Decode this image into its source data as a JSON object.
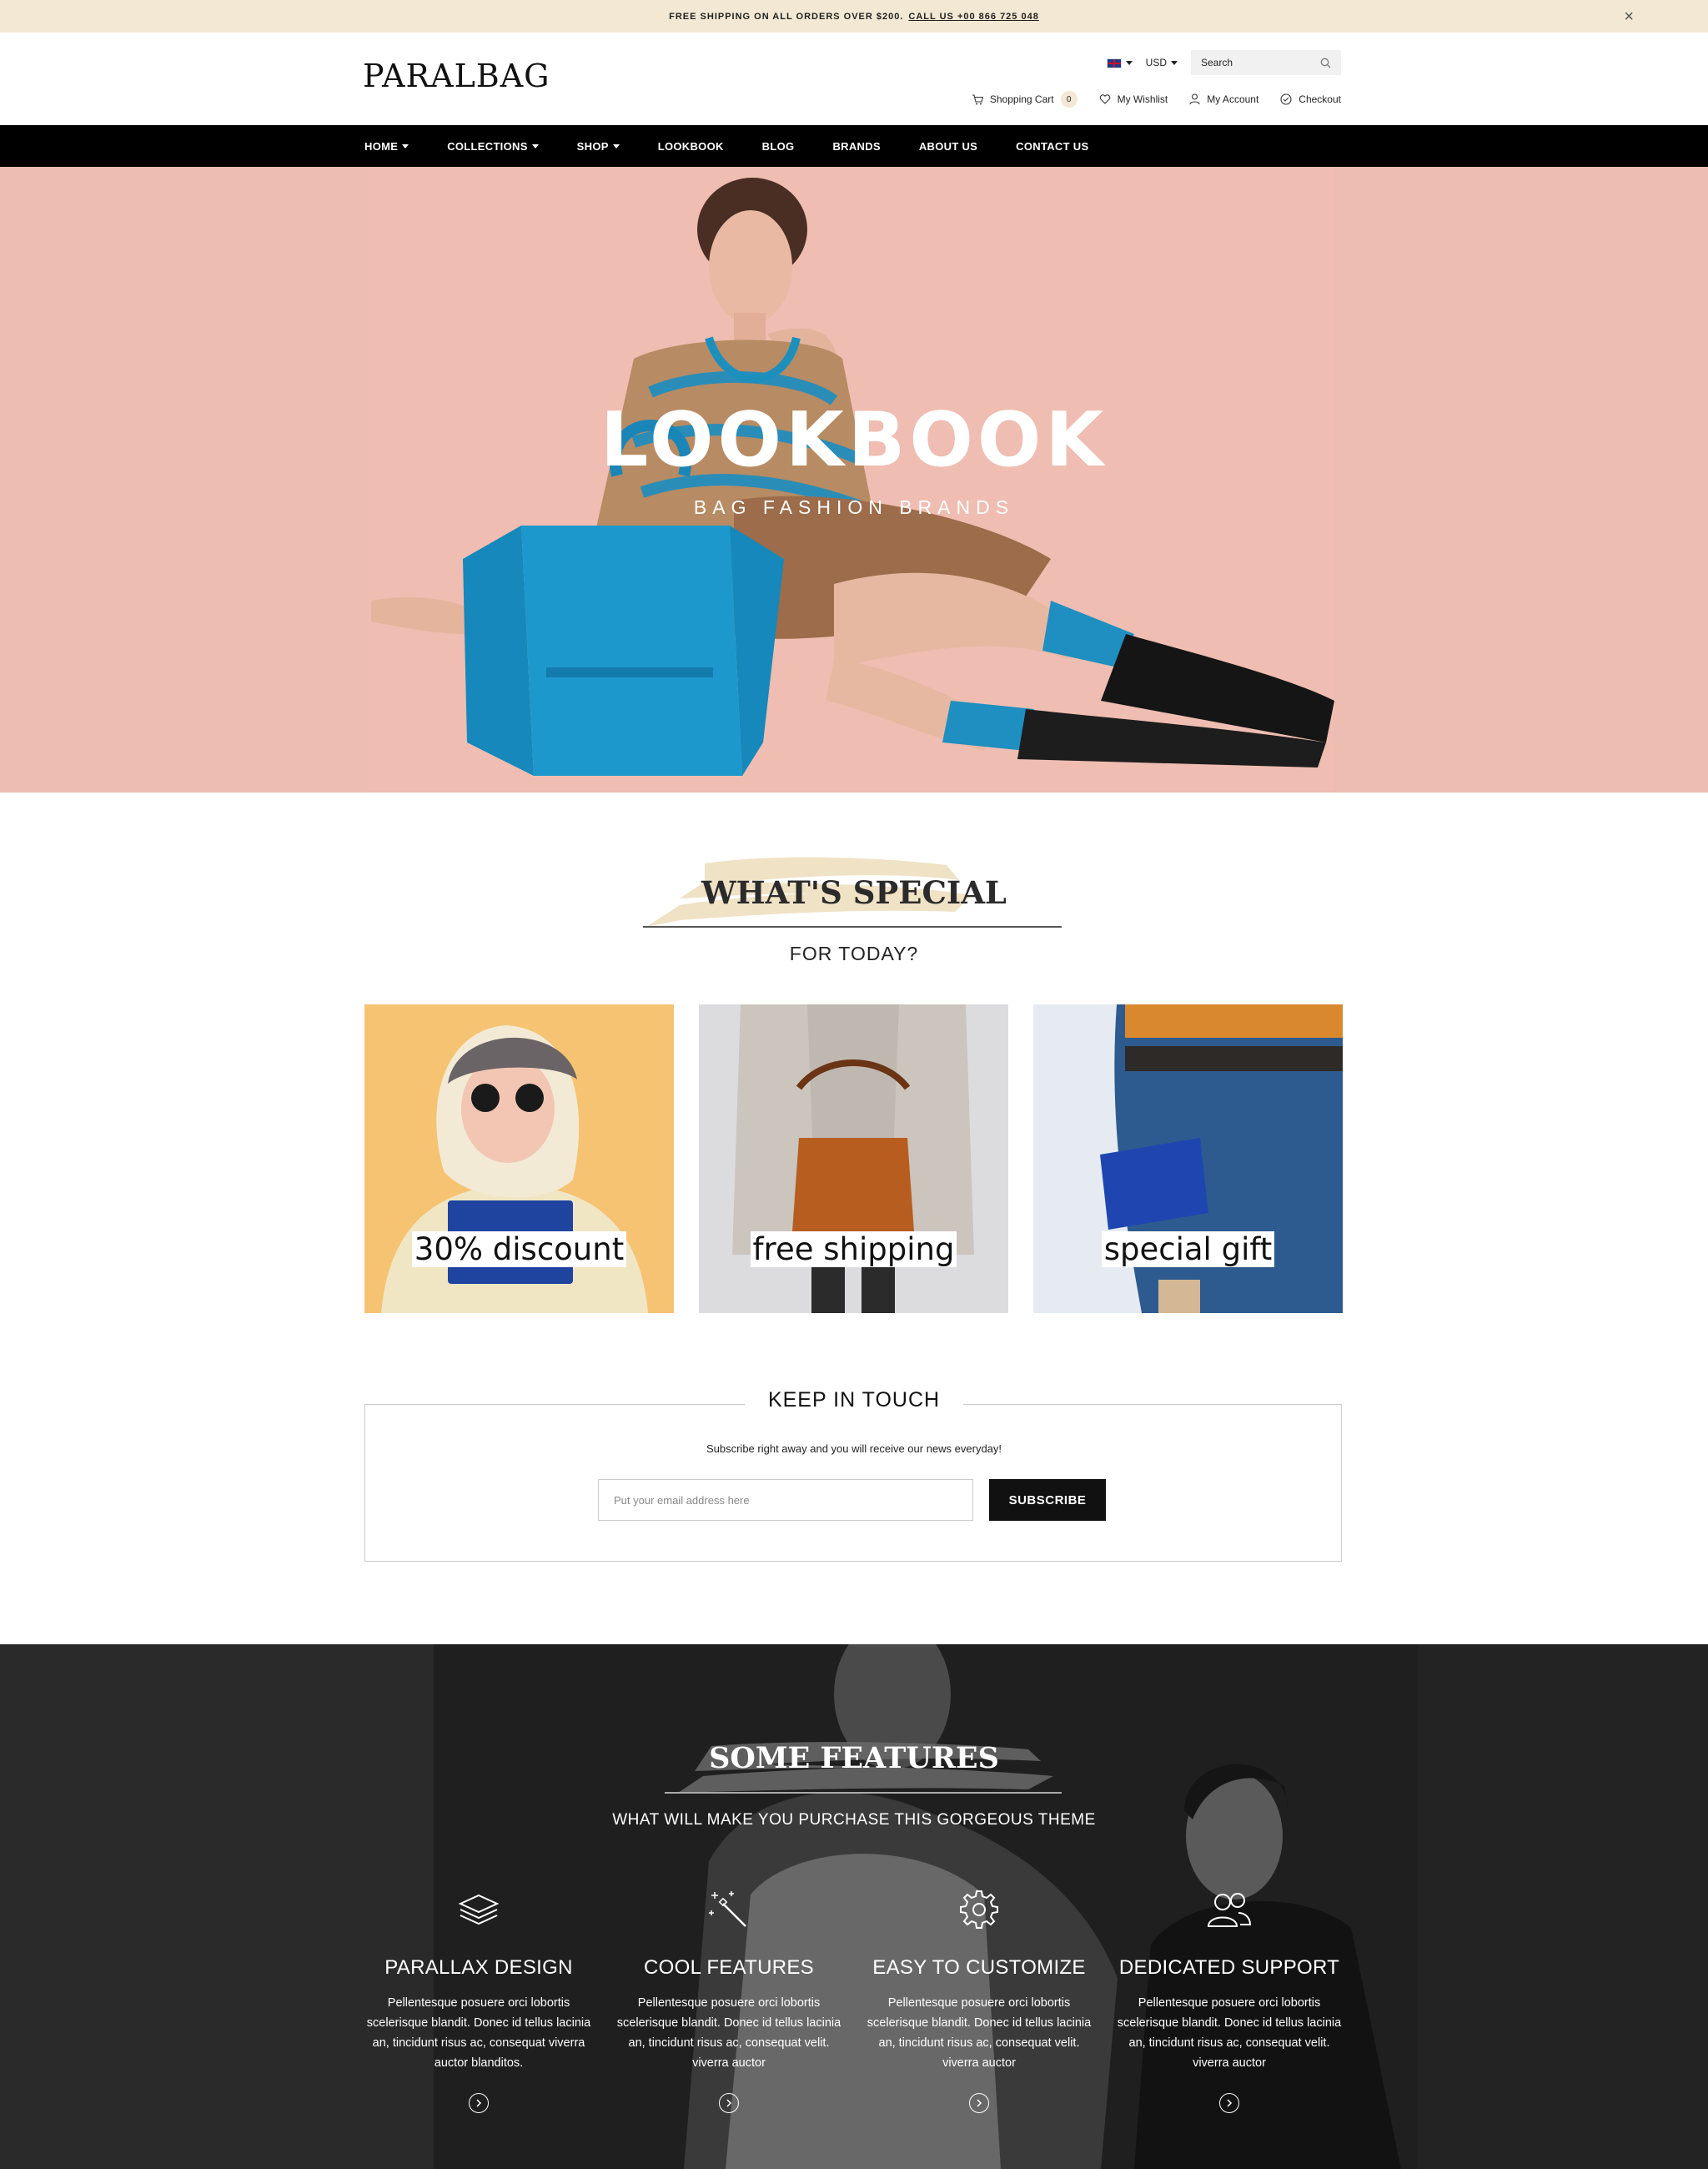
{
  "announcement": {
    "text": "FREE SHIPPING ON ALL ORDERS OVER $200.",
    "phone": "CALL US +00 866 725 048",
    "close": "×"
  },
  "header": {
    "logo": "PARALBAG",
    "currency": "USD",
    "search_label": "Search",
    "links": {
      "cart": "Shopping Cart",
      "cart_count": "0",
      "wishlist": "My Wishlist",
      "account": "My Account",
      "checkout": "Checkout"
    }
  },
  "nav": {
    "items": [
      {
        "label": "HOME"
      },
      {
        "label": "COLLECTIONS"
      },
      {
        "label": "SHOP"
      },
      {
        "label": "LOOKBOOK"
      },
      {
        "label": "BLOG"
      },
      {
        "label": "BRANDS"
      },
      {
        "label": "ABOUT US"
      },
      {
        "label": "CONTACT US"
      }
    ]
  },
  "hero": {
    "title": "LOOKBOOK",
    "subtitle": "BAG FASHION BRANDS",
    "bg_color": "#eebdb2"
  },
  "special": {
    "title": "WHAT'S SPECIAL",
    "subtitle": "FOR TODAY?",
    "cards": [
      {
        "label": "30% discount",
        "bg": "#f5c372"
      },
      {
        "label": "free shipping",
        "bg": "#dcdcdf"
      },
      {
        "label": "special gift",
        "bg": "#e6ebf2"
      }
    ]
  },
  "newsletter": {
    "title": "KEEP IN TOUCH",
    "text": "Subscribe right away and you will receive our news everyday!",
    "placeholder": "Put your email address here",
    "button": "SUBSCRIBE"
  },
  "features": {
    "title": "SOME FEATURES",
    "subtitle": "WHAT WILL MAKE YOU PURCHASE THIS GORGEOUS THEME",
    "items": [
      {
        "icon": "layers-icon",
        "title": "PARALLAX DESIGN",
        "text": "Pellentesque posuere orci lobortis scelerisque blandit. Donec id tellus lacinia an, tincidunt risus ac, consequat viverra auctor blanditos."
      },
      {
        "icon": "magic-wand-icon",
        "title": "COOL FEATURES",
        "text": "Pellentesque posuere orci lobortis scelerisque blandit. Donec id tellus lacinia an, tincidunt risus ac, consequat velit. viverra auctor"
      },
      {
        "icon": "gear-icon",
        "title": "EASY TO CUSTOMIZE",
        "text": "Pellentesque posuere orci lobortis scelerisque blandit. Donec id tellus lacinia an, tincidunt risus ac, consequat velit. viverra auctor"
      },
      {
        "icon": "users-icon",
        "title": "DEDICATED SUPPORT",
        "text": "Pellentesque posuere orci lobortis scelerisque blandit. Donec id tellus lacinia an, tincidunt risus ac, consequat velit. viverra auctor"
      }
    ]
  }
}
